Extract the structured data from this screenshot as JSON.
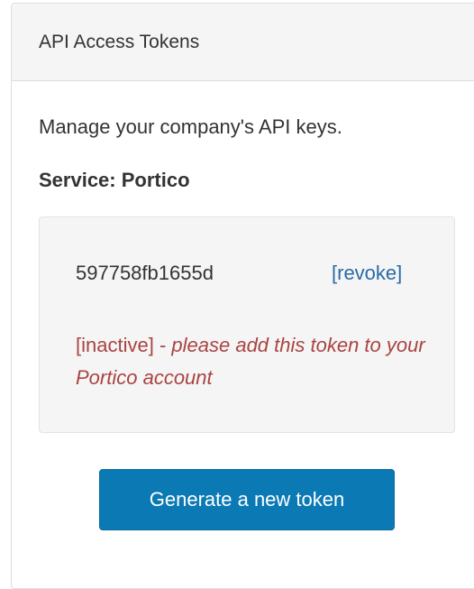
{
  "panel": {
    "title": "API Access Tokens"
  },
  "body": {
    "description": "Manage your company's API keys.",
    "service_label": "Service:",
    "service_name": "Portico"
  },
  "token": {
    "id": "597758fb1655d",
    "revoke_label": "[revoke]",
    "status_tag": "[inactive]",
    "status_separator": " - ",
    "status_note": "please add this token to your Portico account"
  },
  "actions": {
    "generate_label": "Generate a new token"
  },
  "colors": {
    "link": "#2a6aa8",
    "warning_text": "#a94442",
    "primary_button": "#0b79b4",
    "panel_heading_bg": "#f5f5f5",
    "well_bg": "#f5f5f5"
  }
}
